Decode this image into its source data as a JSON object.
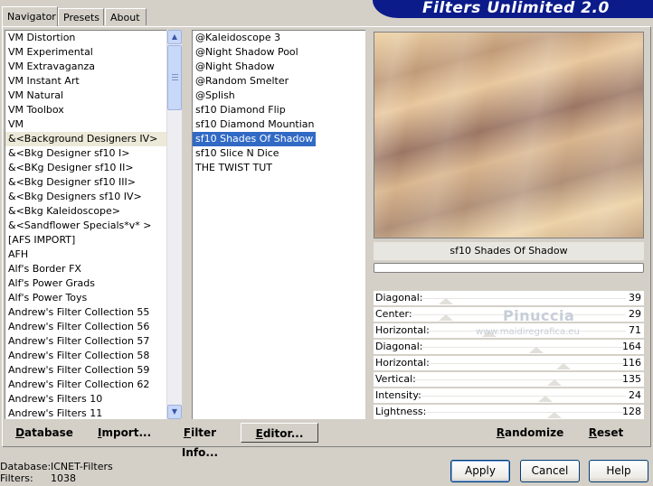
{
  "tabs": [
    {
      "label": "Navigator"
    },
    {
      "label": "Presets"
    },
    {
      "label": "About"
    }
  ],
  "banner": {
    "title": "Filters Unlimited 2.0"
  },
  "categories": [
    "VM Distortion",
    "VM Experimental",
    "VM Extravaganza",
    "VM Instant Art",
    "VM Natural",
    "VM Toolbox",
    "VM",
    "&<Background Designers IV>",
    "&<Bkg Designer sf10 I>",
    "&<BKg Designer sf10 II>",
    "&<Bkg Designer sf10 III>",
    "&<Bkg Designers sf10 IV>",
    "&<Bkg Kaleidoscope>",
    "&<Sandflower Specials*v* >",
    "[AFS IMPORT]",
    "AFH",
    "Alf's Border FX",
    "Alf's Power Grads",
    "Alf's Power Toys",
    "Andrew's Filter Collection 55",
    "Andrew's Filter Collection 56",
    "Andrew's Filter Collection 57",
    "Andrew's Filter Collection 58",
    "Andrew's Filter Collection 59",
    "Andrew's Filter Collection 62",
    "Andrew's Filters 10",
    "Andrew's Filters 11"
  ],
  "filters": [
    "@Kaleidoscope 3",
    "@Night Shadow Pool",
    "@Night Shadow",
    "@Random Smelter",
    "@Splish",
    "sf10 Diamond Flip",
    "sf10 Diamond Mountian",
    "sf10 Shades Of Shadow",
    "sf10 Slice N Dice",
    "THE TWIST TUT"
  ],
  "preview": {
    "filter_name": "sf10 Shades Of Shadow"
  },
  "params": [
    {
      "label": "Diagonal:",
      "value": "39"
    },
    {
      "label": "Center:",
      "value": "29"
    },
    {
      "label": "Horizontal:",
      "value": "71"
    },
    {
      "label": "Diagonal:",
      "value": "164"
    },
    {
      "label": "Horizontal:",
      "value": "116"
    },
    {
      "label": "Vertical:",
      "value": "135"
    },
    {
      "label": "Intensity:",
      "value": "24"
    },
    {
      "label": "Lightness:",
      "value": "128"
    }
  ],
  "watermark": {
    "name": "Pinuccia",
    "url": "www.maidiregrafica.eu"
  },
  "toolbar": {
    "database": "Database",
    "import": "Import...",
    "filter_info": "Filter Info...",
    "editor": "Editor...",
    "randomize": "Randomize",
    "reset": "Reset"
  },
  "status": {
    "database_label": "Database:",
    "database_value": "ICNET-Filters",
    "filters_label": "Filters:",
    "filters_value": "1038"
  },
  "buttons": {
    "apply": "Apply",
    "cancel": "Cancel",
    "help": "Help"
  }
}
